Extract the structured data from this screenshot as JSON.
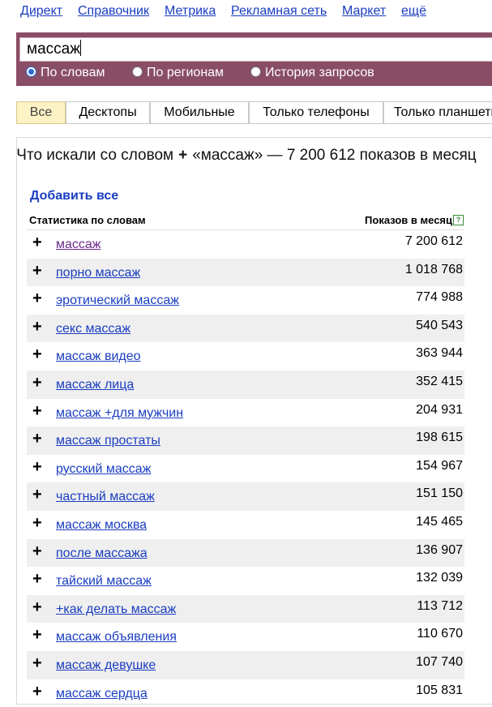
{
  "topnav": [
    {
      "label": "Директ",
      "name": "nav-direct"
    },
    {
      "label": "Справочник",
      "name": "nav-spravochnik"
    },
    {
      "label": "Метрика",
      "name": "nav-metrika"
    },
    {
      "label": "Рекламная сеть",
      "name": "nav-ad-network"
    },
    {
      "label": "Маркет",
      "name": "nav-market"
    },
    {
      "label": "ещё",
      "name": "nav-more"
    }
  ],
  "search": {
    "value": "массаж"
  },
  "radios": [
    {
      "label": "По словам",
      "checked": true
    },
    {
      "label": "По регионам",
      "checked": false
    },
    {
      "label": "История запросов",
      "checked": false
    }
  ],
  "tabs": [
    {
      "label": "Все",
      "active": true
    },
    {
      "label": "Десктопы",
      "active": false
    },
    {
      "label": "Мобильные",
      "active": false
    },
    {
      "label": "Только телефоны",
      "active": false
    },
    {
      "label": "Только планшеты",
      "active": false
    }
  ],
  "headline": {
    "prefix": "Что искали со словом",
    "plus": "+",
    "suffix": "«массаж» — 7 200 612 показов в месяц"
  },
  "add_all": "Добавить все",
  "columns": {
    "left": "Статистика по словам",
    "right": "Показов в месяц",
    "help": "?"
  },
  "row_plus": "+",
  "rows": [
    {
      "phrase": "массаж",
      "count": "7 200 612",
      "visited": true
    },
    {
      "phrase": "порно массаж",
      "count": "1 018 768"
    },
    {
      "phrase": "эротический массаж",
      "count": "774 988"
    },
    {
      "phrase": "секс массаж",
      "count": "540 543"
    },
    {
      "phrase": "массаж видео",
      "count": "363 944"
    },
    {
      "phrase": "массаж лица",
      "count": "352 415"
    },
    {
      "phrase": "массаж +для мужчин",
      "count": "204 931"
    },
    {
      "phrase": "массаж простаты",
      "count": "198 615"
    },
    {
      "phrase": "русский массаж",
      "count": "154 967"
    },
    {
      "phrase": "частный массаж",
      "count": "151 150"
    },
    {
      "phrase": "массаж москва",
      "count": "145 465"
    },
    {
      "phrase": "после массажа",
      "count": "136 907"
    },
    {
      "phrase": "тайский массаж",
      "count": "132 039"
    },
    {
      "phrase": "+как делать массаж",
      "count": "113 712"
    },
    {
      "phrase": "массаж объявления",
      "count": "110 670"
    },
    {
      "phrase": "массаж девушке",
      "count": "107 740"
    },
    {
      "phrase": "массаж сердца",
      "count": "105 831"
    }
  ]
}
